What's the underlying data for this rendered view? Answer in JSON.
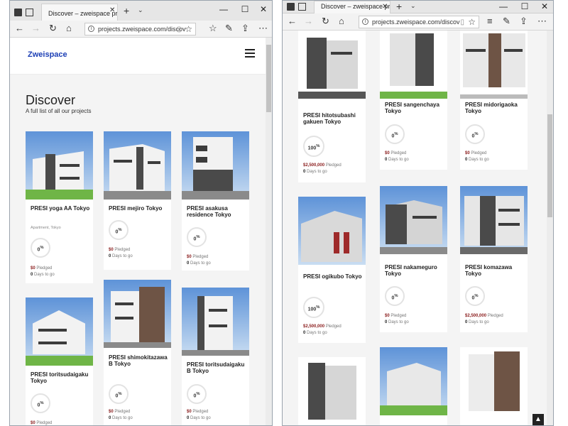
{
  "browser": {
    "tab_title": "Discover – zweispace pr",
    "new_tab": "+",
    "address_left": "projects.zweispace.com/discov",
    "address_right": "projects.zweispace.com/discov"
  },
  "site": {
    "logo": "Zweispace",
    "heading": "Discover",
    "subheading": "A full list of all our projects",
    "pledged_label": "Pledged",
    "days_label": "Days to go"
  },
  "left_cards": [
    {
      "title": "PRESI yoga AA Tokyo",
      "meta": "Apartment, Tokyo",
      "percent": "0",
      "pledged": "$0",
      "days": "0"
    },
    {
      "title": "PRESI mejiro Tokyo",
      "meta": "",
      "percent": "0",
      "pledged": "$0",
      "days": "0"
    },
    {
      "title": "PRESI asakusa residence Tokyo",
      "meta": "",
      "percent": "0",
      "pledged": "$0",
      "days": "0"
    },
    {
      "title": "PRESI toritsudaigaku Tokyo",
      "meta": "",
      "percent": "0",
      "pledged": "$0",
      "days": ""
    },
    {
      "title": "PRESI shimokitazawa B Tokyo",
      "meta": "",
      "percent": "0",
      "pledged": "$0",
      "days": "0"
    },
    {
      "title": "PRESI toritsudaigaku B Tokyo",
      "meta": "",
      "percent": "0",
      "pledged": "$0",
      "days": "0"
    }
  ],
  "right_cards": [
    {
      "title": "PRESI hitotsubashi gakuen Tokyo",
      "percent": "100",
      "pledged": "$2,500,000",
      "days": "0"
    },
    {
      "title": "PRESI sangenchaya Tokyo",
      "percent": "0",
      "pledged": "$0",
      "days": "0"
    },
    {
      "title": "PRESI midorigaoka Tokyo",
      "percent": "0",
      "pledged": "$0",
      "days": "0"
    },
    {
      "title": "PRESI ogikubo Tokyo",
      "percent": "100",
      "pledged": "$2,500,000",
      "days": "0"
    },
    {
      "title": "PRESI nakameguro Tokyo",
      "percent": "0",
      "pledged": "$0",
      "days": "0"
    },
    {
      "title": "PRESI komazawa Tokyo",
      "percent": "0",
      "pledged": "$2,500,000",
      "days": "0"
    }
  ],
  "icons": {
    "back": "←",
    "forward": "→",
    "refresh": "↻",
    "home": "⌂",
    "favorites": "☆",
    "hub": "≡",
    "notes": "✎",
    "share": "⇪",
    "more": "⋯",
    "minimize": "—",
    "maximize": "☐",
    "close": "✕",
    "scroll_top": "▲"
  }
}
